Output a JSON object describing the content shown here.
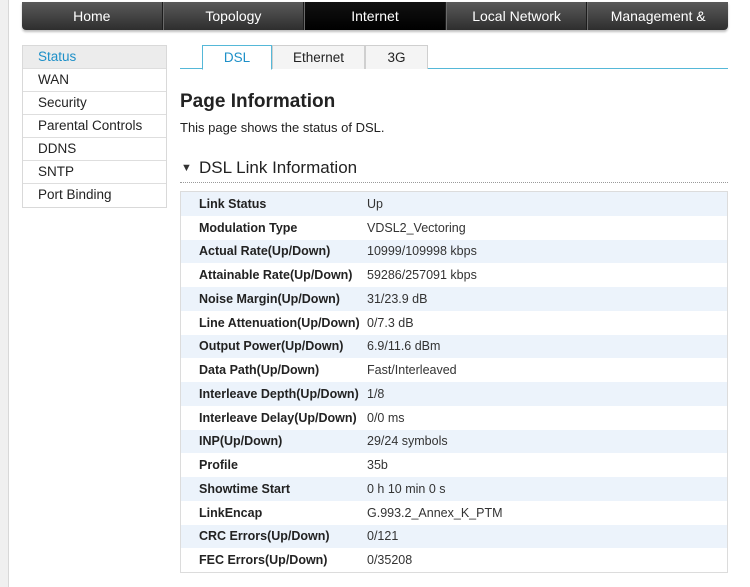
{
  "topnav": {
    "items": [
      {
        "label": "Home"
      },
      {
        "label": "Topology"
      },
      {
        "label": "Internet"
      },
      {
        "label": "Local Network"
      },
      {
        "label": "Management &"
      }
    ]
  },
  "sidebar": {
    "items": [
      {
        "label": "Status"
      },
      {
        "label": "WAN"
      },
      {
        "label": "Security"
      },
      {
        "label": "Parental Controls"
      },
      {
        "label": "DDNS"
      },
      {
        "label": "SNTP"
      },
      {
        "label": "Port Binding"
      }
    ]
  },
  "tabs": [
    {
      "label": "DSL"
    },
    {
      "label": "Ethernet"
    },
    {
      "label": "3G"
    }
  ],
  "page": {
    "title": "Page Information",
    "description": "This page shows the status of DSL."
  },
  "section": {
    "title": "DSL Link Information"
  },
  "dsl_info": [
    {
      "label": "Link Status",
      "value": "Up"
    },
    {
      "label": "Modulation Type",
      "value": "VDSL2_Vectoring"
    },
    {
      "label": "Actual Rate(Up/Down)",
      "value": "10999/109998 kbps"
    },
    {
      "label": "Attainable Rate(Up/Down)",
      "value": "59286/257091 kbps"
    },
    {
      "label": "Noise Margin(Up/Down)",
      "value": "31/23.9 dB"
    },
    {
      "label": "Line Attenuation(Up/Down)",
      "value": "0/7.3 dB"
    },
    {
      "label": "Output Power(Up/Down)",
      "value": "6.9/11.6 dBm"
    },
    {
      "label": "Data Path(Up/Down)",
      "value": "Fast/Interleaved"
    },
    {
      "label": "Interleave Depth(Up/Down)",
      "value": "1/8"
    },
    {
      "label": "Interleave Delay(Up/Down)",
      "value": "0/0 ms"
    },
    {
      "label": "INP(Up/Down)",
      "value": "29/24 symbols"
    },
    {
      "label": "Profile",
      "value": "35b"
    },
    {
      "label": "Showtime Start",
      "value": "0 h 10 min 0 s"
    },
    {
      "label": "LinkEncap",
      "value": "G.993.2_Annex_K_PTM"
    },
    {
      "label": "CRC Errors(Up/Down)",
      "value": "0/121"
    },
    {
      "label": "FEC Errors(Up/Down)",
      "value": "0/35208"
    }
  ]
}
